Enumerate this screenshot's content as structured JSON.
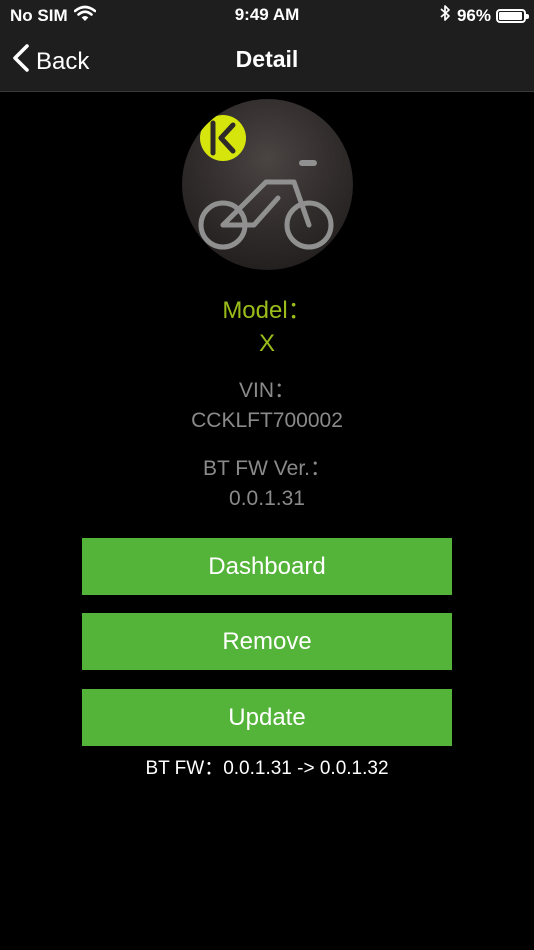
{
  "status_bar": {
    "carrier": "No SIM",
    "time": "9:49 AM",
    "battery_percent": "96%",
    "battery_level": 0.96
  },
  "nav": {
    "back_label": "Back",
    "title": "Detail"
  },
  "device": {
    "model_label": "Model：",
    "model_value": "X",
    "vin_label": "VIN：",
    "vin_value": "CCKLFT700002",
    "fw_label": "BT FW Ver.：",
    "fw_value": "0.0.1.31"
  },
  "actions": {
    "dashboard_label": "Dashboard",
    "remove_label": "Remove",
    "update_label": "Update"
  },
  "update_note": "BT FW：0.0.1.31 -> 0.0.1.32",
  "colors": {
    "accent_green": "#54b43a",
    "model_text": "#9bbd1a",
    "logo_yellow": "#d6e60c",
    "secondary_text": "#8a8a8a",
    "nav_background": "#1e1e1e"
  },
  "icons": {
    "wifi": "wifi-icon",
    "bluetooth": "bluetooth-icon",
    "battery": "battery-icon",
    "back": "chevron-left-icon",
    "brand": "brand-logo-icon",
    "bike": "bicycle-icon"
  }
}
